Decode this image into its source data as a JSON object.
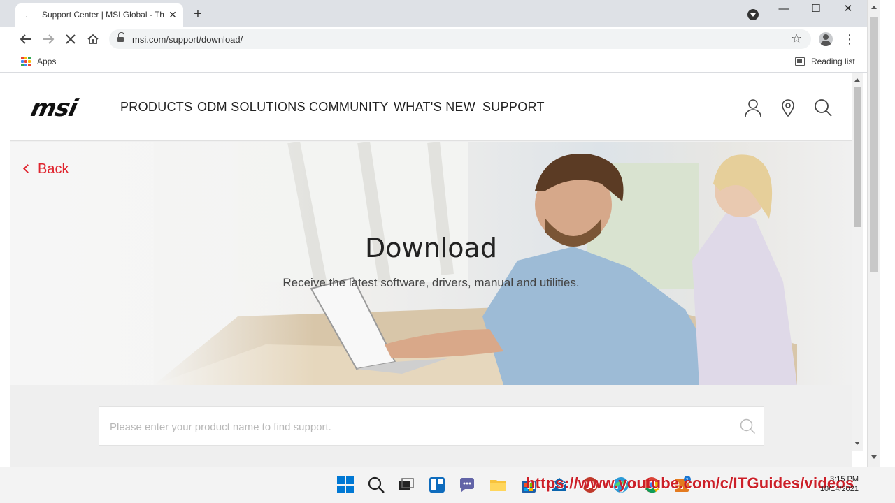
{
  "browser": {
    "tab": {
      "title": "Support Center | MSI Global - Th",
      "favicon": "loading-dot-icon"
    },
    "new_tab_label": "+",
    "window_controls": {
      "minimize": "—",
      "maximize": "☐",
      "close": "✕"
    },
    "address": {
      "url": "msi.com/support/download/"
    },
    "bookmarks": {
      "apps_label": "Apps",
      "reading_list_label": "Reading list"
    }
  },
  "site": {
    "logo": "msi",
    "nav": [
      "PRODUCTS",
      "ODM SOLUTIONS",
      "COMMUNITY",
      "WHAT'S NEW",
      "SUPPORT"
    ],
    "header_icons": [
      "user-icon",
      "location-pin-icon",
      "search-icon"
    ],
    "back_label": "Back",
    "hero": {
      "title": "Download",
      "subtitle": "Receive the latest software, drivers, manual and utilities."
    },
    "search": {
      "placeholder": "Please enter your product name to find support.",
      "value": ""
    },
    "colors": {
      "accent_red": "#e0252f"
    }
  },
  "taskbar": {
    "clock_time": "3:15 PM",
    "clock_date": "10/14/2021",
    "watermark": "https://www.youtube.com/c/ITGuides/videos"
  }
}
